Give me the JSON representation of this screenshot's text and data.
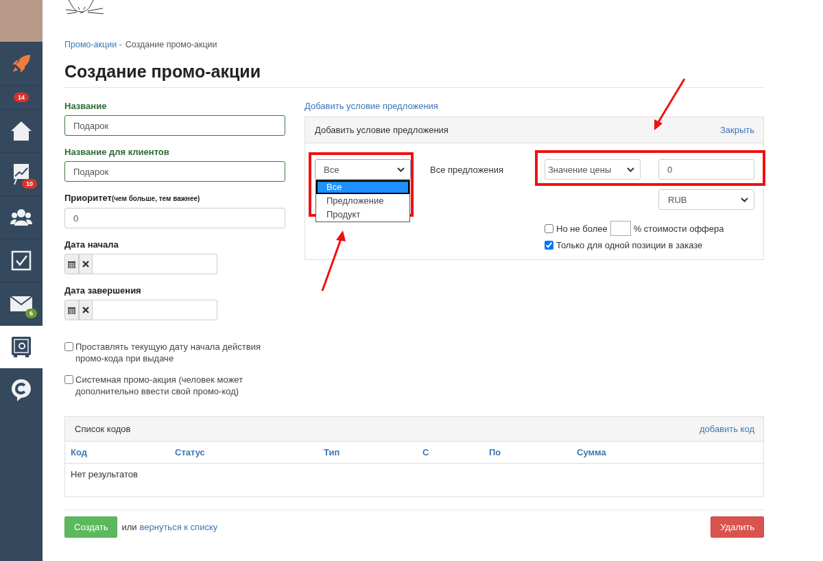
{
  "sidebar": {
    "items": [
      {
        "kind": "rocket",
        "selected": false
      },
      {
        "kind": "badge",
        "badge": "14",
        "color": "#d9312b",
        "selected": false
      },
      {
        "kind": "home",
        "selected": false
      },
      {
        "kind": "chart",
        "badge": "10",
        "color": "#d9312b",
        "selected": false
      },
      {
        "kind": "users",
        "selected": false
      },
      {
        "kind": "tasks",
        "selected": false
      },
      {
        "kind": "mail",
        "badge": "6",
        "color": "#6a9a2e",
        "selected": false
      },
      {
        "kind": "safe",
        "selected": true
      },
      {
        "kind": "chat",
        "selected": false
      }
    ]
  },
  "breadcrumb": {
    "link": "Промо-акции -",
    "current": "Создание промо-акции"
  },
  "title": "Создание промо-акции",
  "form": {
    "fields": [
      {
        "kind": "text",
        "label": "Название",
        "value": "Подарок",
        "valid": true
      },
      {
        "kind": "text",
        "label": "Название для клиентов",
        "value": "Подарок",
        "valid": true
      },
      {
        "kind": "text",
        "label": "Приоритет",
        "hint": "(чем больше, тем важнее)",
        "value": "0",
        "valid": false
      },
      {
        "kind": "date",
        "label": "Дата начала",
        "valid": false
      },
      {
        "kind": "date",
        "label": "Дата завершения",
        "valid": false
      }
    ],
    "checkboxes": [
      {
        "label": "Проставлять текущую дату начала действия промо-кода при выдаче",
        "checked": false
      },
      {
        "label": "Системная промо-акция (человек может дополнительно ввести свой промо-код)",
        "checked": false
      }
    ]
  },
  "offer_condition": {
    "link": "Добавить условие предложения",
    "panel": {
      "title": "Добавить условие предложения",
      "close": "Закрыть",
      "type_select": {
        "value": "Все",
        "expanded": true,
        "options": [
          {
            "label": "Все",
            "selected": true
          },
          {
            "label": "Предложение",
            "selected": false
          },
          {
            "label": "Продукт",
            "selected": false
          }
        ]
      },
      "description": "Все предложения",
      "price_select": {
        "value": "Значение цены"
      },
      "price_input": {
        "value": "0"
      },
      "currency_select": {
        "value": "RUB"
      },
      "options": [
        {
          "kind": "limit",
          "label": "Но не более",
          "suffix": "% стоимости оффера",
          "checked": false
        },
        {
          "kind": "plain",
          "label": "Только для одной позиции в заказе",
          "checked": true
        }
      ]
    }
  },
  "codes": {
    "title": "Список кодов",
    "add": "добавить код",
    "columns": [
      "Код",
      "Статус",
      "Тип",
      "С",
      "По",
      "Сумма"
    ],
    "empty": "Нет результатов"
  },
  "actions": {
    "create": "Создать",
    "or": "или",
    "back": "вернуться к списку",
    "delete": "Удалить"
  }
}
